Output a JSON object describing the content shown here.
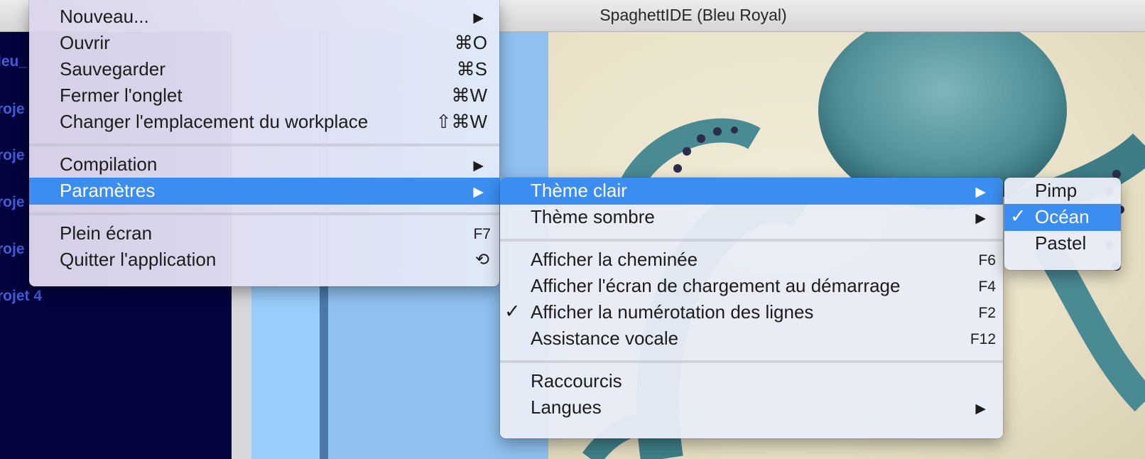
{
  "window": {
    "title": "SpaghettIDE (Bleu Royal)"
  },
  "sidebar": {
    "projects": [
      "leu_",
      "roje",
      "roje",
      "roje",
      "roje",
      "rojet 4"
    ]
  },
  "file_menu": {
    "items": [
      {
        "label": "Nouveau...",
        "submenu": true
      },
      {
        "label": "Ouvrir",
        "shortcut": "⌘O"
      },
      {
        "label": "Sauvegarder",
        "shortcut": "⌘S"
      },
      {
        "label": "Fermer l'onglet",
        "shortcut": "⌘W"
      },
      {
        "label": "Changer l'emplacement du workplace",
        "shortcut": "⇧⌘W"
      },
      {
        "label": "Compilation",
        "submenu": true
      },
      {
        "label": "Paramètres",
        "submenu": true,
        "highlighted": true
      },
      {
        "label": "Plein écran",
        "shortcut": "F7"
      },
      {
        "label": "Quitter l'application",
        "shortcut": "⟲"
      }
    ]
  },
  "settings_menu": {
    "items": [
      {
        "label": "Thème clair",
        "submenu": true,
        "highlighted": true
      },
      {
        "label": "Thème sombre",
        "submenu": true
      },
      {
        "label": "Afficher la cheminée",
        "shortcut": "F6"
      },
      {
        "label": "Afficher l'écran de chargement au démarrage",
        "shortcut": "F4"
      },
      {
        "label": "Afficher la numérotation des lignes",
        "shortcut": "F2",
        "checked": true
      },
      {
        "label": "Assistance vocale",
        "shortcut": "F12"
      },
      {
        "label": "Raccourcis"
      },
      {
        "label": "Langues",
        "submenu": true
      }
    ]
  },
  "theme_menu": {
    "items": [
      {
        "label": "Pimp"
      },
      {
        "label": "Océan",
        "checked": true,
        "highlighted": true
      },
      {
        "label": "Pastel"
      }
    ]
  },
  "glyphs": {
    "arrow": "▶",
    "check": "✓"
  },
  "colors": {
    "highlight": "#3b8ef0",
    "sidebar_bg": "#03033e",
    "project_text": "#3f5fd6"
  }
}
